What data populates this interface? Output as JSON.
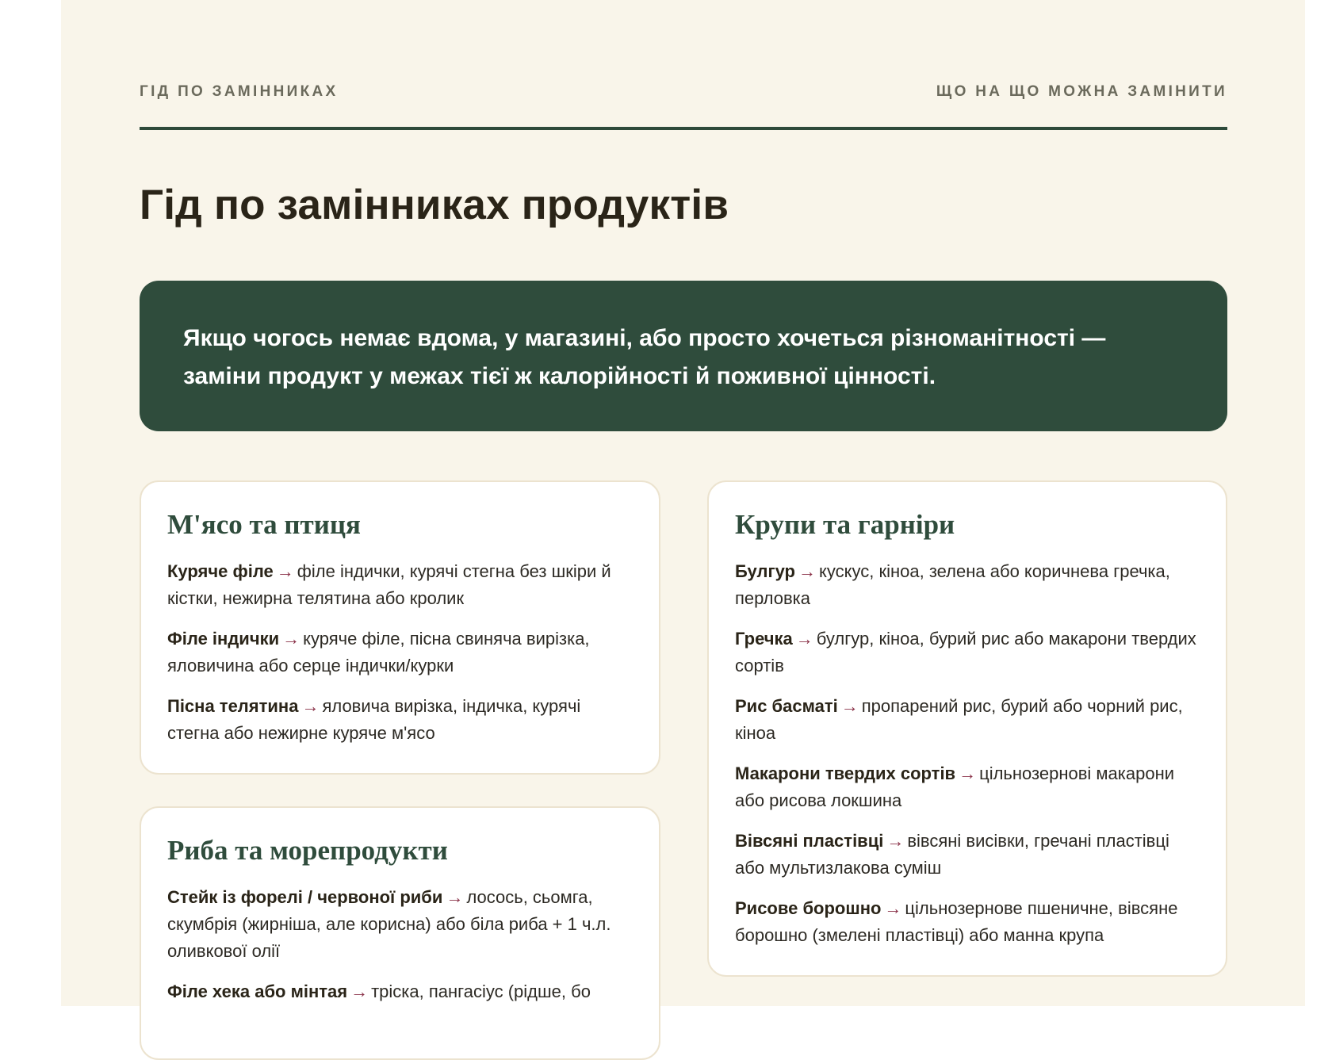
{
  "header": {
    "left_label": "Гід по замінниках",
    "right_label": "Що на що можна замінити"
  },
  "title": "Гід по замінниках продуктів",
  "intro": "Якщо чогось немає вдома, у магазині, або просто хочеться різноманітності — заміни продукт у межах тієї ж калорійності й поживної цінності.",
  "arrow": "→",
  "cards": {
    "meat": {
      "title": "М'ясо та птиця",
      "items": [
        {
          "name": "Куряче філе",
          "alt": "філе індички, курячі стегна без шкіри й кістки, нежирна телятина або кролик"
        },
        {
          "name": "Філе індички",
          "alt": "куряче філе, пісна свиняча вирізка, яловичина або серце індички/курки"
        },
        {
          "name": "Пісна телятина",
          "alt": "яловича вирізка, індичка, курячі стегна або нежирне куряче м'ясо"
        }
      ]
    },
    "fish": {
      "title": "Риба та морепродукти",
      "items": [
        {
          "name": "Стейк із форелі / червоної риби",
          "alt": "лосось, сьомга, скумбрія (жирніша, але корисна) або біла риба + 1 ч.л. оливкової олії"
        },
        {
          "name": "Філе хека або мінтая",
          "alt": "тріска, пангасіус (рідше, бо"
        }
      ]
    },
    "cereal": {
      "title": "Крупи та гарніри",
      "items": [
        {
          "name": "Булгур",
          "alt": "кускус, кіноа, зелена або коричнева гречка, перловка"
        },
        {
          "name": "Гречка",
          "alt": "булгур, кіноа, бурий рис або макарони твердих сортів"
        },
        {
          "name": "Рис басматі",
          "alt": "пропарений рис, бурий або чорний рис, кіноа"
        },
        {
          "name": "Макарони твердих сортів",
          "alt": "цільнозернові макарони або рисова локшина"
        },
        {
          "name": "Вівсяні пластівці",
          "alt": "вівсяні висівки, гречані пластівці або мультизлакова суміш"
        },
        {
          "name": "Рисове борошно",
          "alt": "цільнозернове пшеничне, вівсяне борошно (змелені пластівці) або манна крупа"
        }
      ]
    }
  }
}
